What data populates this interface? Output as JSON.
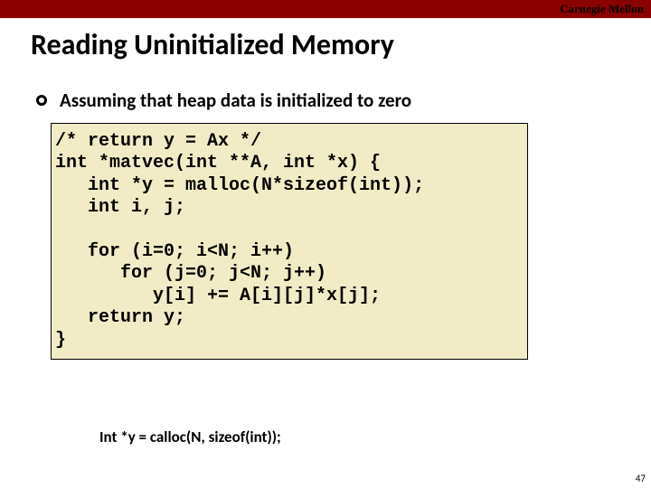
{
  "header": {
    "brand": "Carnegie Mellon"
  },
  "title": "Reading Uninitialized Memory",
  "bullet": {
    "text": "Assuming that heap data is initialized to zero"
  },
  "code": "/* return y = Ax */\nint *matvec(int **A, int *x) {\n   int *y = malloc(N*sizeof(int));\n   int i, j;\n\n   for (i=0; i<N; i++)\n      for (j=0; j<N; j++)\n         y[i] += A[i][j]*x[j];\n   return y;\n}",
  "fix": "Int *y = calloc(N, sizeof(int));",
  "page_number": "47"
}
